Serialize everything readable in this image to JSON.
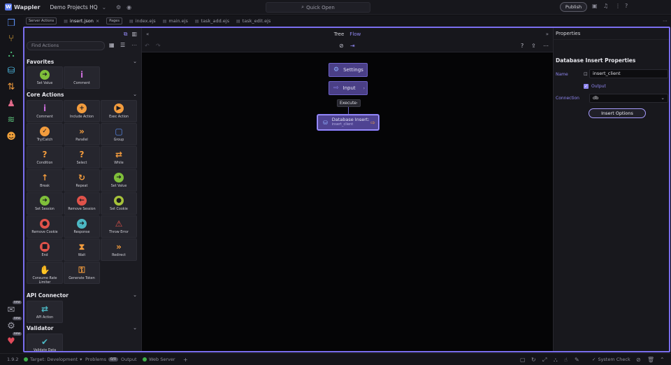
{
  "app": {
    "name": "Wappler",
    "project": "Demo Projects HQ"
  },
  "topbar": {
    "quick_open": "Quick Open",
    "publish": "Publish"
  },
  "tabs": {
    "pill_server": "Server Actions",
    "active_tab": "insert.json",
    "close": "×",
    "pill_pages": "Pages",
    "files": [
      "index.ejs",
      "main.ejs",
      "task_add.ejs",
      "task_edit.ejs"
    ],
    "more": "⋯"
  },
  "actions_panel": {
    "search_placeholder": "Find Actions",
    "sections": {
      "favorites": "Favorites",
      "core": "Core Actions",
      "api": "API Connector",
      "validator": "Validator"
    },
    "favorites": [
      {
        "label": "Set Value",
        "icon": "arrow-right-circle-icon",
        "color": "#7fbf3a"
      },
      {
        "label": "Comment",
        "icon": "info-icon",
        "color": "#c96dd8"
      }
    ],
    "core": [
      {
        "label": "Comment",
        "icon": "info-icon",
        "color": "#c96dd8"
      },
      {
        "label": "Include Action",
        "icon": "plus-circle-icon",
        "color": "#f39c3d"
      },
      {
        "label": "Exec Action",
        "icon": "play-circle-icon",
        "color": "#f39c3d"
      },
      {
        "label": "Try/Catch",
        "icon": "check-circle-icon",
        "color": "#f39c3d"
      },
      {
        "label": "Parallel",
        "icon": "double-chevron-icon",
        "color": "#f39c3d"
      },
      {
        "label": "Group",
        "icon": "group-icon",
        "color": "#5a8df0"
      },
      {
        "label": "Condition",
        "icon": "question-icon",
        "color": "#f39c3d"
      },
      {
        "label": "Select",
        "icon": "question-icon",
        "color": "#f39c3d"
      },
      {
        "label": "While",
        "icon": "loop-icon",
        "color": "#f39c3d"
      },
      {
        "label": "Break",
        "icon": "arrow-up-icon",
        "color": "#f39c3d"
      },
      {
        "label": "Repeat",
        "icon": "repeat-icon",
        "color": "#f39c3d"
      },
      {
        "label": "Set Value",
        "icon": "arrow-right-circle-icon",
        "color": "#7fbf3a"
      },
      {
        "label": "Set Session",
        "icon": "arrow-right-circle-icon",
        "color": "#7fbf3a"
      },
      {
        "label": "Remove Session",
        "icon": "arrow-left-circle-icon",
        "color": "#e0524a"
      },
      {
        "label": "Set Cookie",
        "icon": "cookie-icon",
        "color": "#a6c23a"
      },
      {
        "label": "Remove Cookie",
        "icon": "cookie-icon",
        "color": "#e0524a"
      },
      {
        "label": "Response",
        "icon": "arrow-right-circle-icon",
        "color": "#4cb8c4"
      },
      {
        "label": "Throw Error",
        "icon": "warning-icon",
        "color": "#e0524a"
      },
      {
        "label": "End",
        "icon": "stop-circle-icon",
        "color": "#e0524a"
      },
      {
        "label": "Wait",
        "icon": "hourglass-icon",
        "color": "#f39c3d"
      },
      {
        "label": "Redirect",
        "icon": "double-chevron-icon",
        "color": "#f39c3d"
      },
      {
        "label": "Consume Rate Limiter",
        "icon": "hand-icon",
        "color": "#f39c3d"
      },
      {
        "label": "Generate Token",
        "icon": "key-icon",
        "color": "#f39c3d"
      }
    ],
    "api": [
      {
        "label": "API Action",
        "icon": "swap-icon",
        "color": "#4cb8c4"
      }
    ],
    "validator": [
      {
        "label": "Validate Data",
        "icon": "checkmark-icon",
        "color": "#4cb8c4"
      }
    ]
  },
  "canvas": {
    "view_tree": "Tree",
    "view_flow": "Flow",
    "nodes": {
      "settings": "Settings",
      "input": "Input",
      "execute": "Execute",
      "db_title": "Database Insert:",
      "db_sub": "insert_client"
    }
  },
  "properties": {
    "header": "Properties",
    "title": "Database Insert Properties",
    "name_label": "Name",
    "name_value": "insert_client",
    "output_label": "Output",
    "connection_label": "Connection",
    "connection_value": "db",
    "insert_options": "Insert Options"
  },
  "statusbar": {
    "zoom": "1.9.2",
    "target": "Target: Development",
    "problems": "Problems",
    "problems_count": "0/0",
    "output": "Output",
    "web_server": "Web Server",
    "system_check": "System Check"
  }
}
